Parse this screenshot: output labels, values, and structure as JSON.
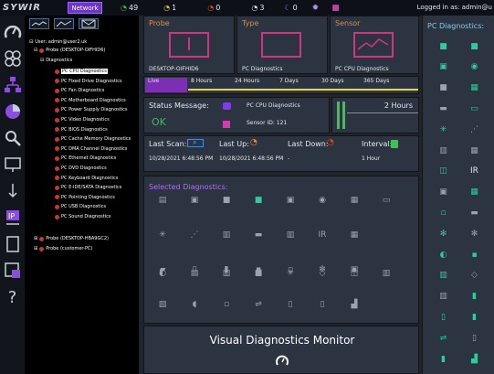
{
  "topbar": {
    "logo": "SYWIR",
    "network_tab": "Network",
    "stats": [
      {
        "icon": "gauge-icon",
        "color": "#3fb957",
        "value": "49"
      },
      {
        "icon": "gauge-icon",
        "color": "#e8c43a",
        "value": "1"
      },
      {
        "icon": "gauge-icon",
        "color": "#d9482b",
        "value": "0"
      },
      {
        "icon": "gauge-icon",
        "color": "#d6d9de",
        "value": "3"
      },
      {
        "icon": "moon-icon",
        "color": "#9c70f0",
        "value": "0"
      }
    ],
    "logged_in": "Logged in as: admin@u"
  },
  "tree": {
    "user": "User: admin@user2.uk",
    "probe1": "Probe (DESKTOP-OIFHID6)",
    "diagnostics": "Diagnostics",
    "items": [
      "PC CPU Diagnostics",
      "PC Fixed Drive Diagnostics",
      "PC Fan Diagnostics",
      "PC Motherboard Diagnostics",
      "PC Power Supply Diagnostics",
      "PC Video Diagnostics",
      "PC BIOS Diagnostics",
      "PC Cache Memory Diagnostics",
      "PC DMA Channel Diagnostics",
      "PC Ethernet Diagnostics",
      "PC DVD Diagnostics",
      "PC Keyboard Diagnostics",
      "PC E-IDE/SATA Diagnostics",
      "PC Pointing Diagnostics",
      "PC USB Diagnostics",
      "PC Sound Diagnostics"
    ],
    "probe2": "Probe (DESKTOP-HBA9GC2)",
    "probe3": "Probe (customer-PC)"
  },
  "probe_panel": {
    "title": "Probe",
    "label": "DESKTOP-OIFHID6"
  },
  "type_panel": {
    "title": "Type",
    "label": "PC Diagnostics"
  },
  "sensor_panel": {
    "title": "Sensor",
    "label": "PC CPU Diagnostics"
  },
  "ranges": [
    "Live",
    "8 Hours",
    "24 Hours",
    "7 Days",
    "30 Days",
    "365 Days"
  ],
  "status": {
    "label": "Status Message:",
    "value": "OK",
    "sensor_name": "PC CPU Diagnostics",
    "sensor_id": "Sensor ID:  121"
  },
  "interval_box": {
    "value": "2 Hours"
  },
  "scan": {
    "last_scan_label": "Last Scan:",
    "last_scan": "10/28/2021 6:48:56 PM",
    "last_up_label": "Last Up:",
    "last_up": "10/28/2021 6:48:56 PM",
    "last_down_label": "Last Down:",
    "last_down": "-",
    "interval_label": "Interval:",
    "interval": "1 Hour"
  },
  "selected": {
    "title": "Selected Diagnostics:",
    "ir": "IR"
  },
  "right": {
    "title": "PC Diagnostics:",
    "ir": "IR"
  },
  "footer": {
    "title": "Visual Diagnostics Monitor"
  },
  "colors": {
    "accent": "#e58a3e",
    "magenta": "#cf3580",
    "live": "#7b2fb3",
    "range_line": "#e8d73a",
    "ok": "#3fb957",
    "right_icon": "#2ecc9a"
  }
}
